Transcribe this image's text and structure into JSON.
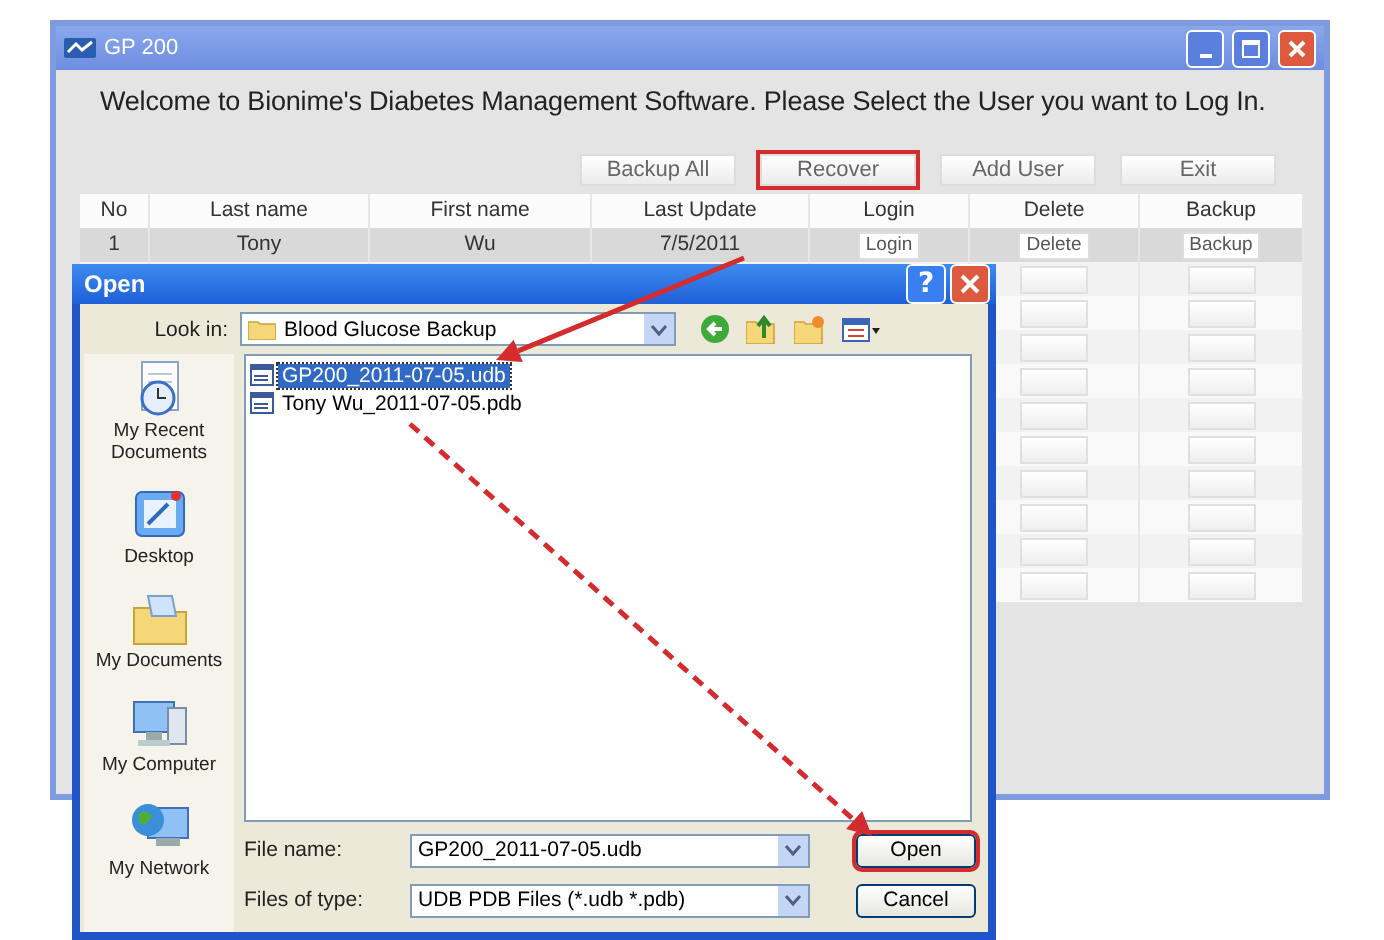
{
  "main_window": {
    "title": "GP 200",
    "welcome": "Welcome to Bionime's Diabetes Management Software. Please Select the User you want to Log In.",
    "buttons": [
      {
        "label": "Backup All",
        "highlighted": false
      },
      {
        "label": "Recover",
        "highlighted": true
      },
      {
        "label": "Add User",
        "highlighted": false
      },
      {
        "label": "Exit",
        "highlighted": false
      }
    ],
    "table": {
      "columns": [
        "No",
        "Last name",
        "First name",
        "Last Update",
        "Login",
        "Delete",
        "Backup"
      ],
      "rows": [
        {
          "kind": "user",
          "no": "1",
          "last_name": "Tony",
          "first_name": "Wu",
          "last_update": "7/5/2011",
          "login": "Login",
          "delete": "Delete",
          "backup": "Backup"
        },
        {
          "kind": "empty"
        },
        {
          "kind": "empty"
        },
        {
          "kind": "empty"
        },
        {
          "kind": "empty"
        },
        {
          "kind": "empty"
        },
        {
          "kind": "empty"
        },
        {
          "kind": "empty"
        },
        {
          "kind": "empty"
        },
        {
          "kind": "empty"
        },
        {
          "kind": "empty"
        }
      ]
    }
  },
  "open_dialog": {
    "title": "Open",
    "help": "?",
    "look_in": {
      "label": "Look in:",
      "value": "Blood Glucose Backup"
    },
    "places": [
      {
        "kind": "recent",
        "label": "My Recent Documents"
      },
      {
        "kind": "desktop",
        "label": "Desktop"
      },
      {
        "kind": "documents",
        "label": "My Documents"
      },
      {
        "kind": "computer",
        "label": "My Computer"
      },
      {
        "kind": "network",
        "label": "My Network"
      }
    ],
    "files": [
      {
        "name": "GP200_2011-07-05.udb",
        "selected": true
      },
      {
        "name": "Tony Wu_2011-07-05.pdb",
        "selected": false
      }
    ],
    "file_name": {
      "label": "File name:",
      "value": "GP200_2011-07-05.udb"
    },
    "file_type": {
      "label": "Files of type:",
      "value": "UDB PDB Files (*.udb *.pdb)"
    },
    "buttons": [
      {
        "label": "Open",
        "highlighted": true
      },
      {
        "label": "Cancel",
        "highlighted": false
      }
    ]
  },
  "annotations": [
    {
      "kind": "solid"
    },
    {
      "kind": "dashed"
    }
  ]
}
